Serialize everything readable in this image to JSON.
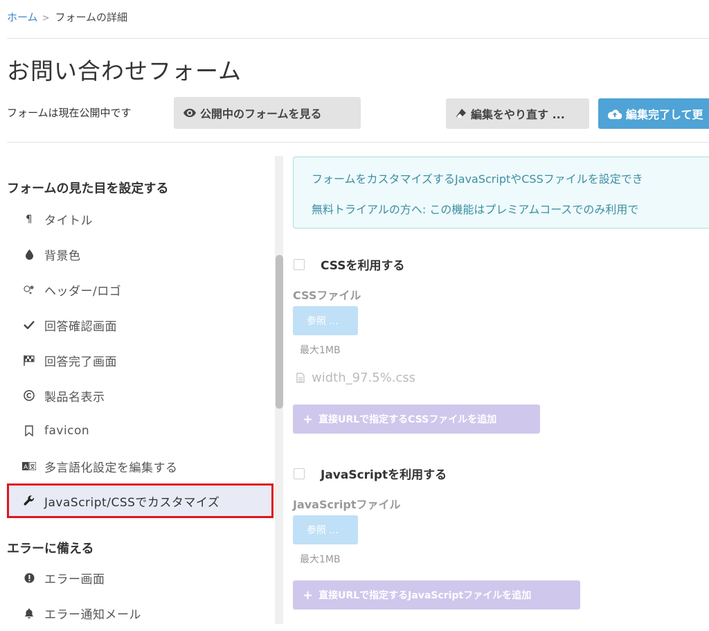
{
  "breadcrumb": {
    "home": "ホーム",
    "separator": ">",
    "current": "フォームの詳細"
  },
  "page": {
    "title": "お問い合わせフォーム"
  },
  "status": {
    "text": "フォームは現在公開中です"
  },
  "buttons": {
    "view_form": "公開中のフォームを見る",
    "redo_edit": "編集をやり直す ...",
    "finish_edit": "編集完了して更"
  },
  "sidebar": {
    "section_appearance": "フォームの見た目を設定する",
    "items": [
      {
        "label": "タイトル",
        "icon": "paragraph-icon"
      },
      {
        "label": "背景色",
        "icon": "tint-drop-icon"
      },
      {
        "label": "ヘッダー/ロゴ",
        "icon": "header-logo-icon"
      },
      {
        "label": "回答確認画面",
        "icon": "check-icon"
      },
      {
        "label": "回答完了画面",
        "icon": "flag-checkered-icon"
      },
      {
        "label": "製品名表示",
        "icon": "copyright-icon"
      },
      {
        "label": "favicon",
        "icon": "bookmark-icon"
      },
      {
        "label": "多言語化設定を編集する",
        "icon": "language-icon"
      },
      {
        "label": "JavaScript/CSSでカスタマイズ",
        "icon": "wrench-icon",
        "active": true
      }
    ],
    "section_error": "エラーに備える",
    "error_items": [
      {
        "label": "エラー画面",
        "icon": "exclamation-circle-icon"
      },
      {
        "label": "エラー通知メール",
        "icon": "bell-icon"
      }
    ]
  },
  "info": {
    "line1": "フォームをカスタマイズするJavaScriptやCSSファイルを設定でき",
    "line2": "無料トライアルの方へ: この機能はプレミアムコースでのみ利用で"
  },
  "css_section": {
    "checkbox_label": "CSSを利用する",
    "file_label": "CSSファイル",
    "browse": "参照 ...",
    "max_size": "最大1MB",
    "file_name": "width_97.5%.css",
    "add_button": "直接URLで指定するCSSファイルを追加"
  },
  "js_section": {
    "checkbox_label": "JavaScriptを利用する",
    "file_label": "JavaScriptファイル",
    "browse": "参照 ...",
    "max_size": "最大1MB",
    "add_button": "直接URLで指定するJavaScriptファイルを追加"
  },
  "colors": {
    "link": "#3a86c8",
    "primary_button": "#4fa3d6",
    "highlight_border": "#e0151b",
    "active_item_bg": "#e8eaf6",
    "info_text": "#3d8ea3",
    "add_button": "#cfc8ec"
  }
}
